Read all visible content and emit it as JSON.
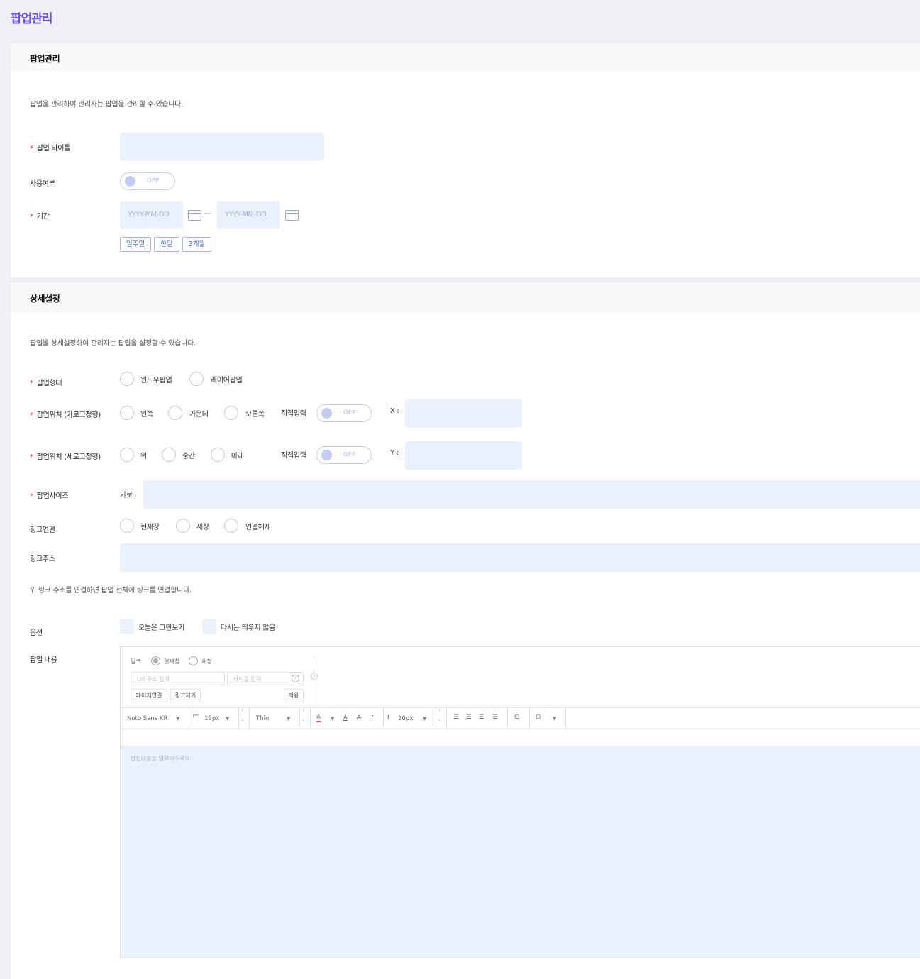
{
  "page_title": "팝업관리",
  "section1": {
    "header": "팝업관리",
    "description": "팝업을 관리하여 관리자는 팝업을 관리할 수 있습니다.",
    "title_label": "팝업 타이틀",
    "title_value": "",
    "usage_label": "사용여부",
    "usage_toggle": "OFF",
    "period_label": "기간",
    "date_start_placeholder": "YYYY-MM-DD",
    "date_end_placeholder": "YYYY-MM-DD",
    "date_separator": "—",
    "quick_ranges": [
      "일주일",
      "한달",
      "3개월"
    ]
  },
  "section2": {
    "header": "상세설정",
    "description": "팝업을 상세설정하여 관리자는 팝업을 설정할 수 있습니다.",
    "type_label": "팝업형태",
    "type_options": [
      "윈도우팝업",
      "레이어팝업"
    ],
    "hpos_label": "팝업위치 (가로고정형)",
    "hpos_options": [
      "왼쪽",
      "가운데",
      "오른쪽"
    ],
    "vpos_label": "팝업위치 (세로고정형)",
    "vpos_options": [
      "위",
      "중간",
      "아래"
    ],
    "direct_input_label": "직접입력",
    "direct_toggle": "OFF",
    "x_label": "X :",
    "y_label": "Y :",
    "size_label": "팝업사이즈",
    "width_label": "가로 :",
    "link_label": "링크연결",
    "link_options": [
      "현재창",
      "새창",
      "연결해제"
    ],
    "link_addr_label": "링크주소",
    "link_note": "위 링크 주소를 연결하면 팝업 전체에 링크를 연결합니다.",
    "option_label": "옵션",
    "option_checks": [
      "오늘은 그만보기",
      "다시는 띄우지 않음"
    ],
    "content_label": "팝업 내용"
  },
  "editor": {
    "link_label": "링크",
    "link_modes": [
      "현재창",
      "새창"
    ],
    "url_placeholder": "Url 주소 입력",
    "title_placeholder": "타이틀 입력",
    "page_link_btn": "페이지연결",
    "remove_link_btn": "링크제거",
    "apply_btn": "적용",
    "font_family": "Noto Sans KR",
    "font_size": "19px",
    "font_weight": "Thin",
    "line_height": "20px",
    "content_placeholder": "팝업내용을 입력해주세요."
  }
}
